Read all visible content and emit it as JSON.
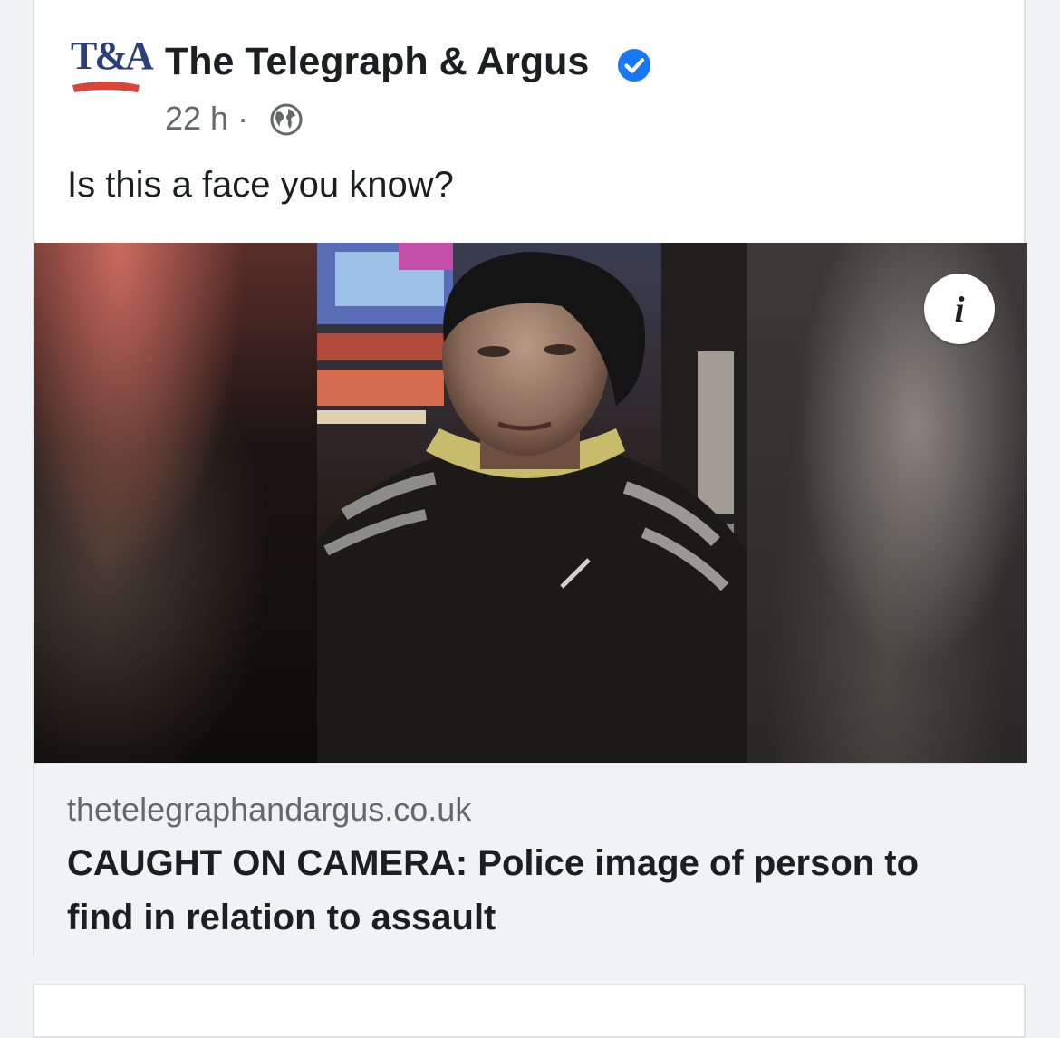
{
  "post": {
    "page_name": "The Telegraph & Argus",
    "logo_text": "T&A",
    "time": "22 h",
    "separator": "·",
    "message": "Is this a face you know?"
  },
  "icons": {
    "verified": "verified-badge-icon",
    "audience": "globe-icon",
    "info": "info-icon"
  },
  "media": {
    "info_label": "i"
  },
  "link_preview": {
    "domain": "thetelegraphandargus.co.uk",
    "headline": "CAUGHT ON CAMERA: Police image of person to find in relation to assault"
  },
  "colors": {
    "brand_navy": "#2a3f78",
    "brand_red": "#d9453a",
    "verified_blue": "#1877f2",
    "text_primary": "#1c1e21",
    "text_secondary": "#65676b"
  }
}
